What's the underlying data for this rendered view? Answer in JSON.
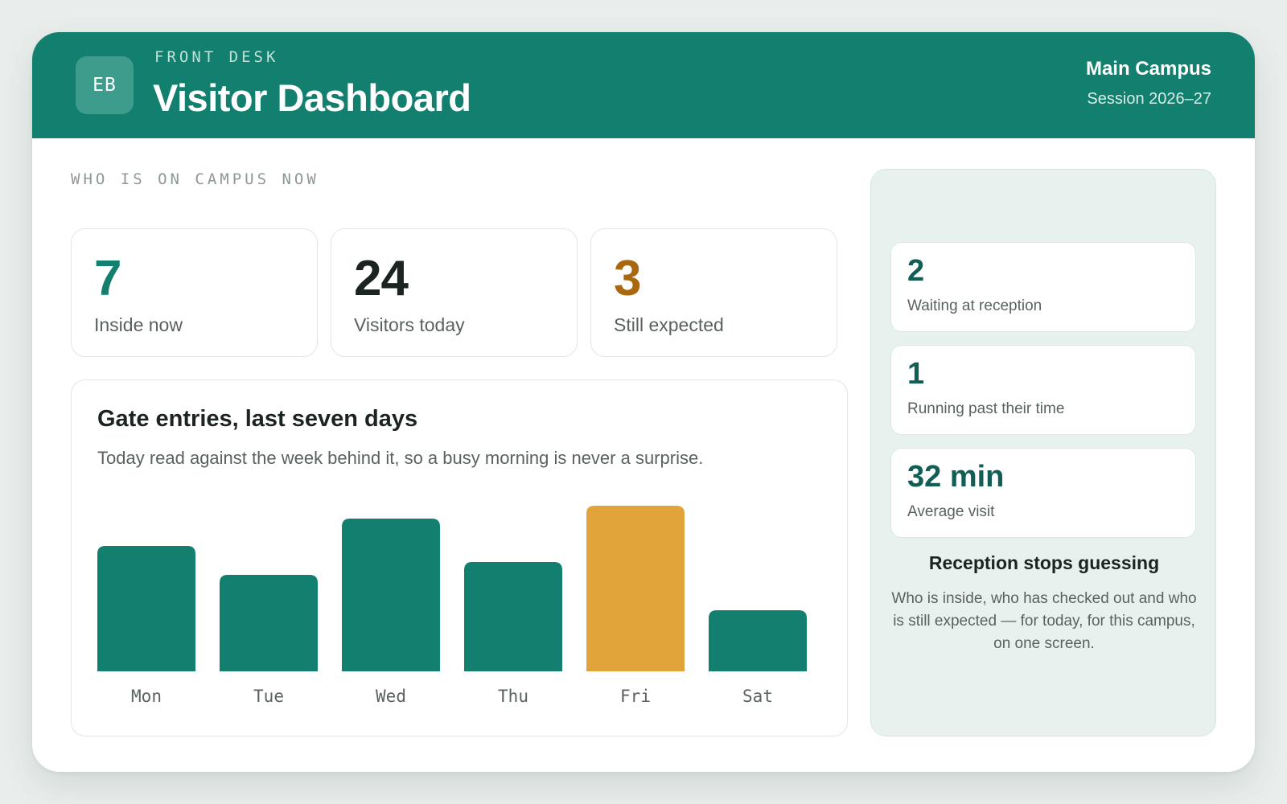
{
  "header": {
    "logo_initials": "EB",
    "eyebrow": "FRONT DESK",
    "title": "Visitor Dashboard",
    "campus": "Main Campus",
    "session": "Session 2026–27"
  },
  "section_label": "WHO IS ON CAMPUS NOW",
  "stats": [
    {
      "value": "7",
      "label": "Inside now",
      "color": "#127f6f"
    },
    {
      "value": "24",
      "label": "Visitors today",
      "color": "#1b2421"
    },
    {
      "value": "3",
      "label": "Still expected",
      "color": "#a9680f"
    }
  ],
  "chart": {
    "title": "Gate entries, last seven days",
    "subtitle": "Today read against the week behind it, so a busy morning is never a surprise."
  },
  "chart_data": {
    "type": "bar",
    "categories": [
      "Mon",
      "Tue",
      "Wed",
      "Thu",
      "Fri",
      "Sat"
    ],
    "values": [
      78,
      60,
      95,
      68,
      103,
      38
    ],
    "highlight_index": 4,
    "colors": {
      "bar": "#127f6f",
      "highlight": "#e0a43a"
    },
    "ylim": [
      0,
      103
    ],
    "grid": false
  },
  "side": {
    "items": [
      {
        "value": "2",
        "label": "Waiting at reception"
      },
      {
        "value": "1",
        "label": "Running past their time"
      },
      {
        "value": "32 min",
        "label": "Average visit"
      }
    ],
    "title": "Reception stops guessing",
    "text": "Who is inside, who has checked out and who is still expected — for today, for this campus, on one screen."
  }
}
